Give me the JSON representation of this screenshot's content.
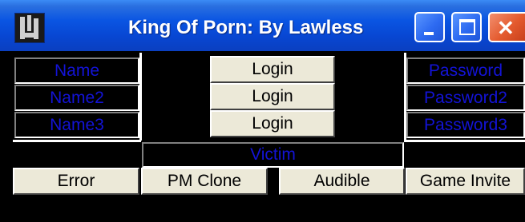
{
  "window": {
    "title": "King Of Porn: By Lawless",
    "title_bar_color": "#0a55e2",
    "close_button_color": "#e45a2e",
    "input_text_color": "#1313d6",
    "button_face_color": "#ece9d8"
  },
  "title_buttons": {
    "minimize": "minimize-icon",
    "maximize": "maximize-icon",
    "close": "✕"
  },
  "left_fields": [
    "Name",
    "Name2",
    "Name3"
  ],
  "login_buttons": [
    "Login",
    "Login",
    "Login"
  ],
  "right_fields": [
    "Password",
    "Password2",
    "Password3"
  ],
  "victim_field": "Victim",
  "action_buttons": [
    "Error",
    "PM Clone",
    "Audible",
    "Game Invite"
  ]
}
